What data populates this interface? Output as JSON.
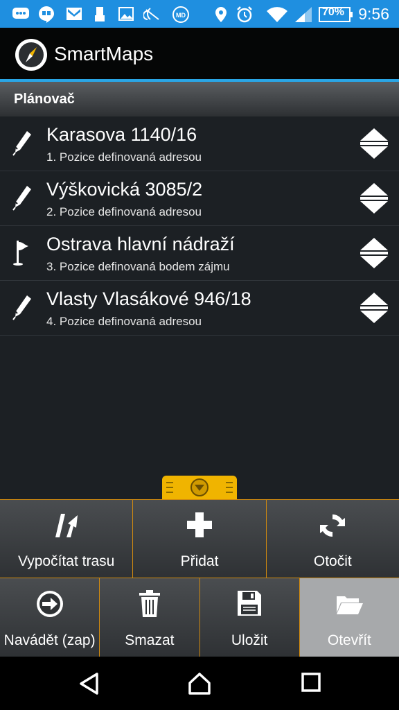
{
  "status": {
    "battery": "70%",
    "time": "9:56",
    "icons": [
      "chat-icon",
      "hangouts-icon",
      "gmail-icon",
      "usb-icon",
      "image-icon",
      "nfc-icon",
      "md-icon",
      "location-icon",
      "alarm-icon",
      "wifi-icon",
      "signal-icon",
      "battery-icon"
    ]
  },
  "app": {
    "title": "SmartMaps"
  },
  "section": {
    "title": "Plánovač"
  },
  "items": [
    {
      "title": "Karasova 1140/16",
      "subtitle": "1. Pozice definovaná adresou",
      "icon": "pencil-icon"
    },
    {
      "title": "Výškovická 3085/2",
      "subtitle": "2. Pozice definovaná adresou",
      "icon": "pencil-icon"
    },
    {
      "title": "Ostrava hlavní nádraží",
      "subtitle": "3. Pozice definovaná bodem zájmu",
      "icon": "flag-icon"
    },
    {
      "title": "Vlasty Vlasákové 946/18",
      "subtitle": "4. Pozice definovaná adresou",
      "icon": "pencil-icon"
    }
  ],
  "actions_row1": [
    {
      "label": "Vypočítat trasu",
      "icon": "route-icon"
    },
    {
      "label": "Přidat",
      "icon": "plus-icon"
    },
    {
      "label": "Otočit",
      "icon": "rotate-icon"
    }
  ],
  "actions_row2": [
    {
      "label": "Navádět (zap)",
      "icon": "arrow-circle-icon"
    },
    {
      "label": "Smazat",
      "icon": "trash-icon"
    },
    {
      "label": "Uložit",
      "icon": "save-icon"
    },
    {
      "label": "Otevřít",
      "icon": "folder-open-icon",
      "active": true
    }
  ],
  "colors": {
    "statusbar": "#1f8fe0",
    "accent": "#2aa6e6",
    "handle": "#f0b400",
    "divider": "#d08a10"
  }
}
